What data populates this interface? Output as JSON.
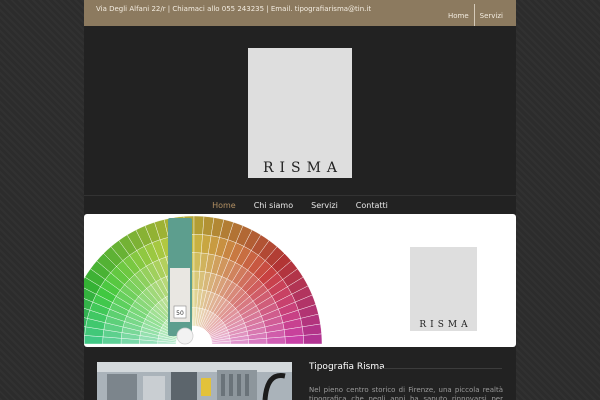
{
  "topbar": {
    "contact": "Via Degli Alfani 22/r | Chiamaci allo 055 243235 | Email. tipografiarisma@tin.it",
    "nav": [
      {
        "label": "Home"
      },
      {
        "label": "Servizi"
      }
    ]
  },
  "logo": {
    "text": "RISMA"
  },
  "mainnav": {
    "items": [
      {
        "label": "Home",
        "active": true
      },
      {
        "label": "Chi siamo",
        "active": false
      },
      {
        "label": "Servizi",
        "active": false
      },
      {
        "label": "Contatti",
        "active": false
      }
    ]
  },
  "hero": {
    "logo_text": "RISMA",
    "fan_card_number": "50"
  },
  "about": {
    "title": "Tipografia Risma",
    "text": "Nel pieno centro storico di Firenze, una piccola realtà tipografica che negli anni ha saputo rinnovarsi per offrire ai"
  },
  "colors": {
    "topbar": "#8c7a5f",
    "accent": "#b29063",
    "page_bg": "#222222"
  }
}
